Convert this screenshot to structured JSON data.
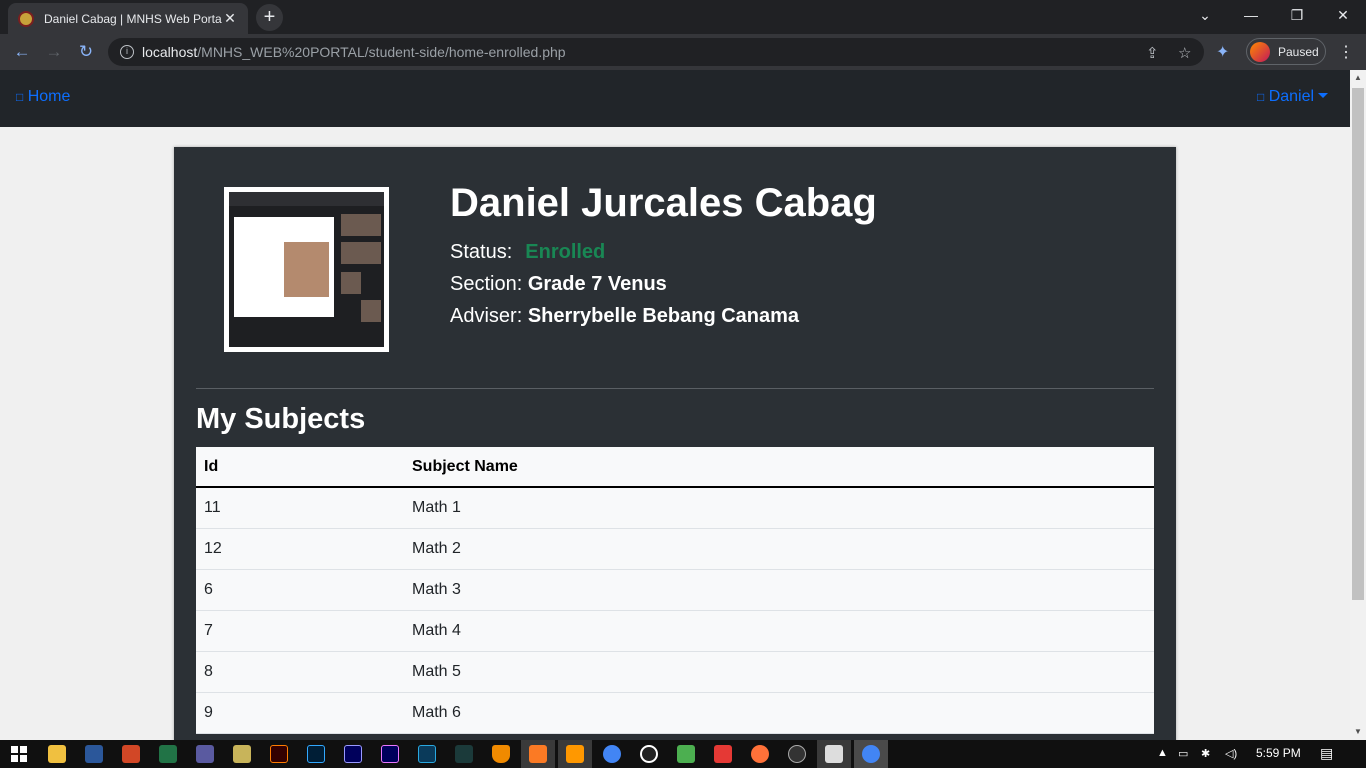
{
  "browser": {
    "tab_title": "Daniel Cabag | MNHS Web Portal",
    "tab_close": "✕",
    "new_tab": "+",
    "url_host": "localhost",
    "url_path": "/MNHS_WEB%20PORTAL/student-side/home-enrolled.php",
    "profile_status": "Paused",
    "window_controls": {
      "dropdown": "⌄",
      "minimize": "—",
      "restore": "❐",
      "close": "✕"
    }
  },
  "navbar": {
    "home_icon": "□",
    "home_label": "Home",
    "user_icon": "□",
    "user_label": "Daniel"
  },
  "profile": {
    "full_name": "Daniel Jurcales Cabag",
    "status_label": "Status:",
    "status_value": "Enrolled",
    "section_label": "Section:",
    "section_value": "Grade 7 Venus",
    "adviser_label": "Adviser:",
    "adviser_value": "Sherrybelle Bebang Canama"
  },
  "subjects": {
    "title": "My Subjects",
    "columns": [
      "Id",
      "Subject Name"
    ],
    "rows": [
      {
        "id": "11",
        "name": "Math 1"
      },
      {
        "id": "12",
        "name": "Math 2"
      },
      {
        "id": "6",
        "name": "Math 3"
      },
      {
        "id": "7",
        "name": "Math 4"
      },
      {
        "id": "8",
        "name": "Math 5"
      },
      {
        "id": "9",
        "name": "Math 6"
      }
    ]
  },
  "taskbar": {
    "time": "5:59 PM"
  },
  "colors": {
    "accent": "#0d6efd",
    "enrolled": "#198754",
    "card_bg": "#2b3035",
    "navbar_bg": "#212529"
  }
}
